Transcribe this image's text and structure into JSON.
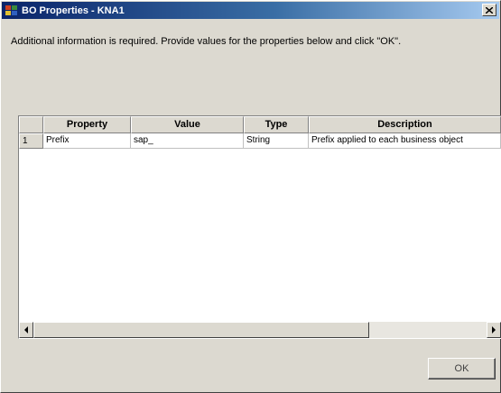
{
  "window": {
    "title": "BO Properties - KNA1",
    "close_label": "x"
  },
  "instructions": "Additional information is required. Provide values for the properties below and click \"OK\".",
  "table": {
    "columns": [
      "",
      "Property",
      "Value",
      "Type",
      "Description"
    ],
    "rows": [
      {
        "row_number": "1",
        "property": "Prefix",
        "value": "sap_",
        "type": "String",
        "description": "Prefix applied to each business object"
      }
    ]
  },
  "scrollbar": {
    "left_icon": "left-arrow-icon",
    "right_icon": "right-arrow-icon"
  },
  "buttons": {
    "ok_label": "OK"
  },
  "colors": {
    "title_gradient_start": "#0a246a",
    "title_gradient_end": "#a6caf0",
    "dialog_background": "#dcd9d0"
  }
}
